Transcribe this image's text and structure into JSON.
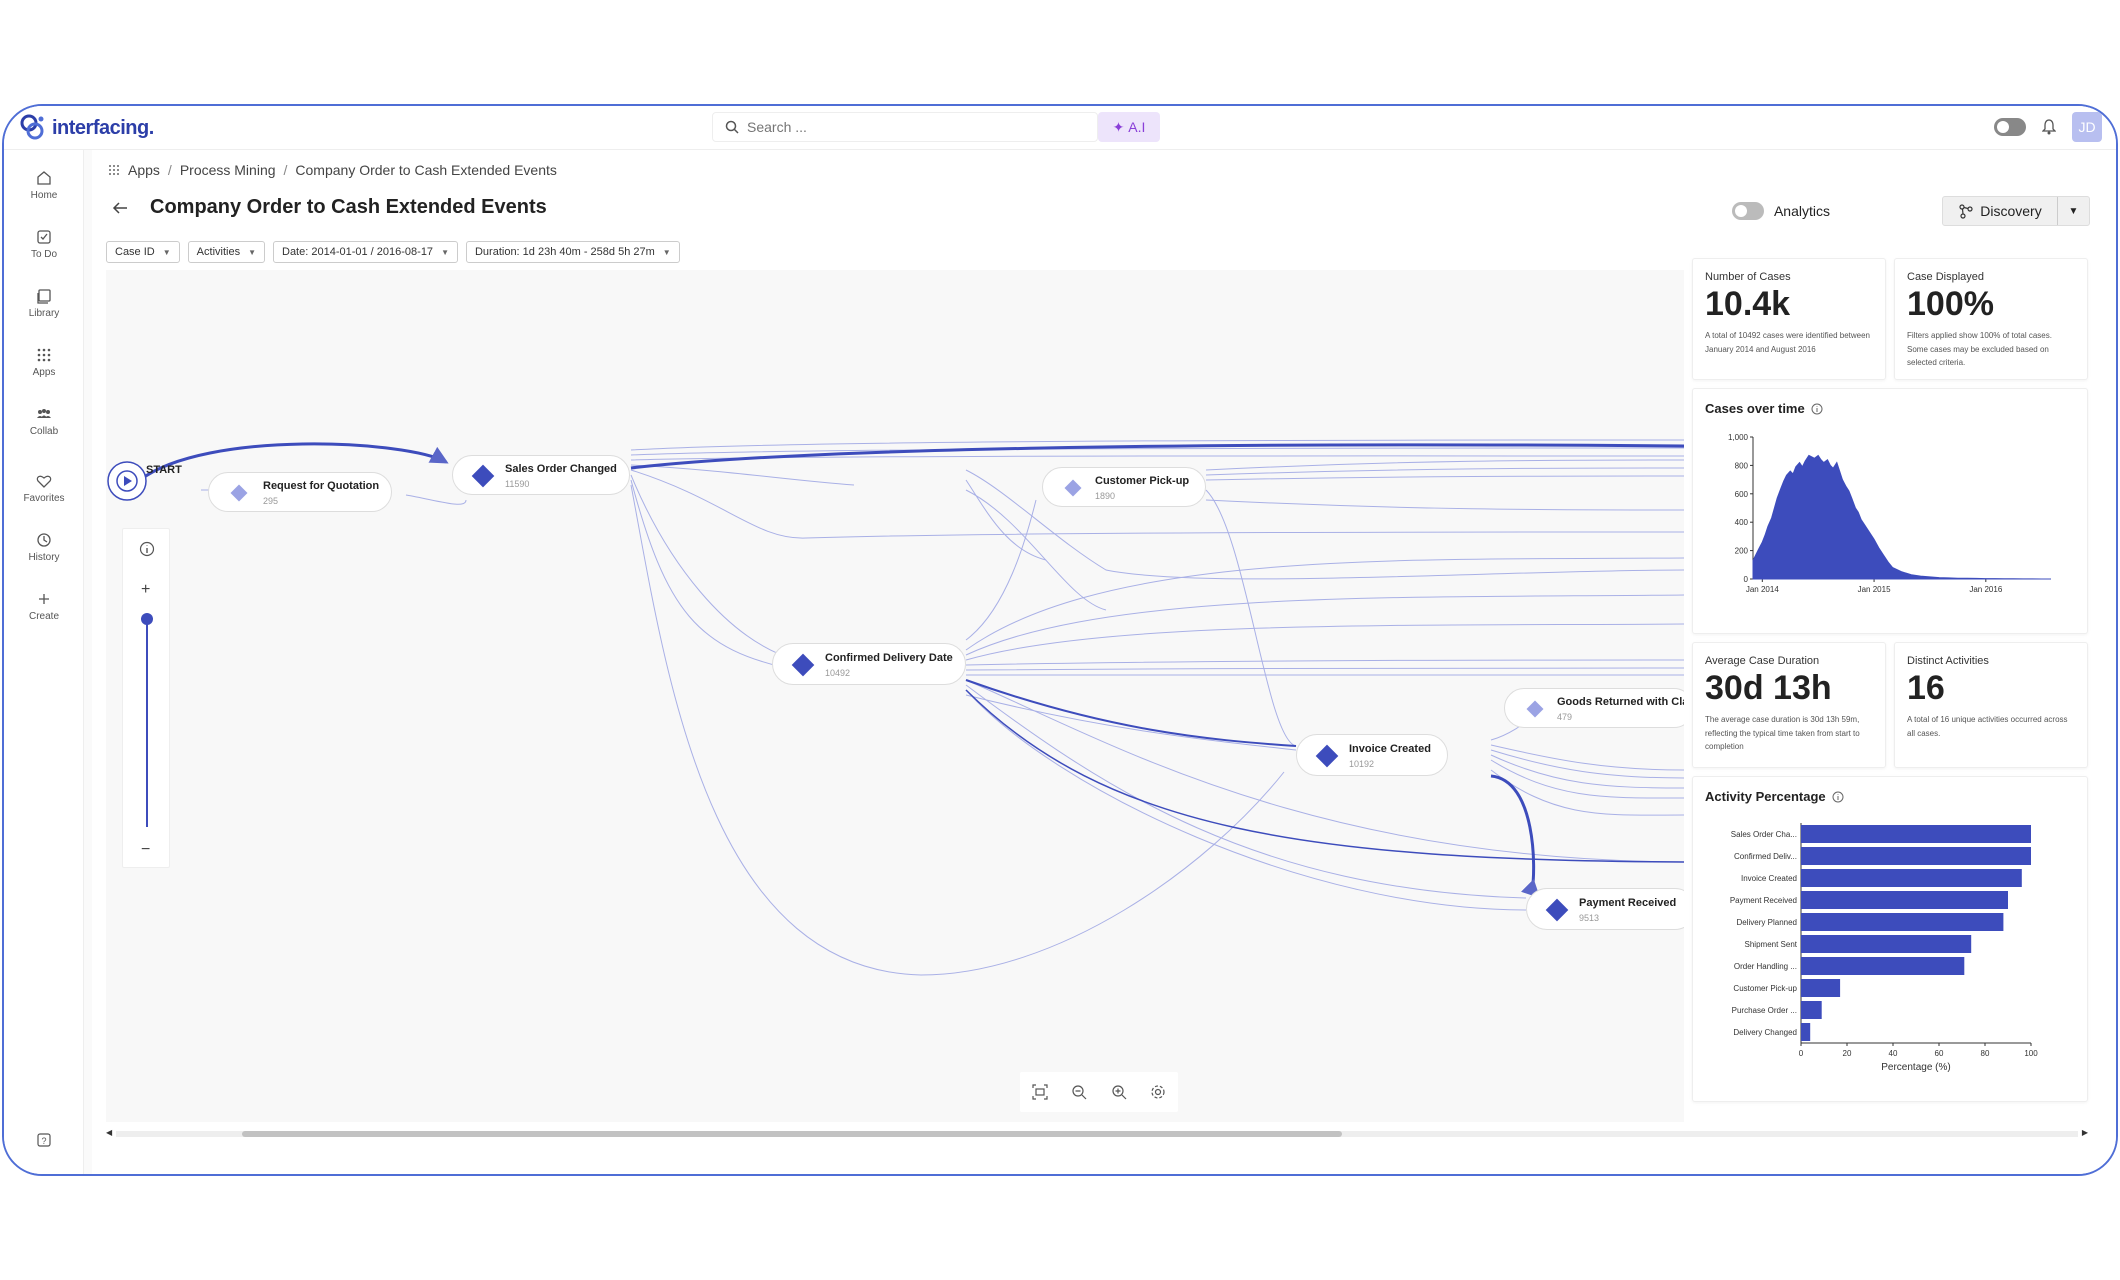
{
  "app": {
    "logo": "interfacing."
  },
  "search": {
    "placeholder": "Search ..."
  },
  "ai_button": {
    "label": "A.I"
  },
  "user": {
    "initials": "JD"
  },
  "sidebar": {
    "items": [
      {
        "label": "Home",
        "icon": "home-icon"
      },
      {
        "label": "To Do",
        "icon": "todo-icon"
      },
      {
        "label": "Library",
        "icon": "library-icon"
      },
      {
        "label": "Apps",
        "icon": "apps-icon"
      },
      {
        "label": "Collab",
        "icon": "collab-icon"
      },
      {
        "label": "Favorites",
        "icon": "heart-icon"
      },
      {
        "label": "History",
        "icon": "history-icon"
      },
      {
        "label": "Create",
        "icon": "plus-icon"
      }
    ]
  },
  "breadcrumb": [
    "Apps",
    "Process Mining",
    "Company Order to Cash Extended Events"
  ],
  "page": {
    "title": "Company Order to Cash Extended Events"
  },
  "toolbar": {
    "analytics_label": "Analytics",
    "discovery_label": "Discovery"
  },
  "filters": [
    {
      "label": "Case ID"
    },
    {
      "label": "Activities"
    },
    {
      "label": "Date: 2014-01-01 / 2016-08-17"
    },
    {
      "label": "Duration: 1d 23h 40m - 258d 5h 27m"
    }
  ],
  "process_map": {
    "start_label": "START",
    "nodes": [
      {
        "name": "Request for Quotation",
        "count": "295"
      },
      {
        "name": "Sales Order Changed",
        "count": "11590"
      },
      {
        "name": "Customer Pick-up",
        "count": "1890"
      },
      {
        "name": "Confirmed Delivery Date",
        "count": "10492"
      },
      {
        "name": "Goods Returned with Clair",
        "count": "479"
      },
      {
        "name": "Invoice Created",
        "count": "10192"
      },
      {
        "name": "Payment Received",
        "count": "9513"
      }
    ]
  },
  "kpis": {
    "cases": {
      "label": "Number of Cases",
      "value": "10.4k",
      "desc": "A total of 10492 cases were identified between January 2014 and August 2016"
    },
    "displayed": {
      "label": "Case Displayed",
      "value": "100%",
      "desc": "Filters applied show 100% of total cases. Some cases may be excluded based on selected criteria."
    },
    "duration": {
      "label": "Average Case Duration",
      "value": "30d 13h",
      "desc": "The average case duration is 30d 13h 59m, reflecting the typical time taken from start to completion"
    },
    "activities": {
      "label": "Distinct Activities",
      "value": "16",
      "desc": "A total of 16 unique activities occurred across all cases."
    }
  },
  "chart_data": [
    {
      "type": "area",
      "title": "Cases over time",
      "ylim": [
        0,
        1000
      ],
      "y_ticks": [
        "0",
        "200",
        "400",
        "600",
        "800",
        "1,000"
      ],
      "x_ticks": [
        "Jan 2014",
        "Jan 2015",
        "Jan 2016"
      ],
      "x": [
        0,
        0.3,
        0.6,
        1,
        1.3,
        1.6,
        2,
        2.3,
        2.6,
        3,
        3.3,
        3.6,
        4,
        4.3,
        4.6,
        5,
        5.3,
        5.6,
        6,
        6.3,
        6.6,
        7,
        7.3,
        7.6,
        8,
        8.3,
        8.6,
        9,
        9.3,
        9.6,
        10,
        10.3,
        10.6,
        11,
        11.3,
        11.6,
        12,
        12.5,
        13,
        13.5,
        14,
        14.5,
        15,
        16,
        17,
        18,
        19,
        20,
        21,
        22,
        23,
        24,
        25,
        26,
        27,
        28,
        29,
        30,
        31,
        32
      ],
      "values": [
        130,
        170,
        210,
        260,
        310,
        370,
        430,
        500,
        570,
        640,
        690,
        730,
        760,
        740,
        790,
        820,
        790,
        830,
        870,
        860,
        850,
        870,
        840,
        820,
        840,
        800,
        780,
        820,
        760,
        700,
        650,
        620,
        570,
        500,
        470,
        420,
        380,
        330,
        280,
        220,
        170,
        120,
        80,
        50,
        30,
        20,
        15,
        10,
        8,
        5,
        5,
        4,
        3,
        3,
        2,
        2,
        1,
        1,
        0,
        0
      ],
      "x_range": [
        0,
        32
      ]
    },
    {
      "type": "bar",
      "orientation": "horizontal",
      "title": "Activity Percentage",
      "xlabel": "Percentage (%)",
      "xlim": [
        0,
        100
      ],
      "x_ticks": [
        "0",
        "20",
        "40",
        "60",
        "80",
        "100"
      ],
      "categories": [
        "Sales Order Cha...",
        "Confirmed Deliv...",
        "Invoice Created",
        "Payment Received",
        "Delivery Planned",
        "Shipment Sent",
        "Order Handling ...",
        "Customer Pick-up",
        "Purchase Order ...",
        "Delivery Changed"
      ],
      "values": [
        100,
        100,
        96,
        90,
        88,
        74,
        71,
        17,
        9,
        4
      ]
    }
  ],
  "colors": {
    "accent": "#3d4cbc",
    "brand": "#2c3ea8",
    "ai": "#8a3fd8"
  }
}
